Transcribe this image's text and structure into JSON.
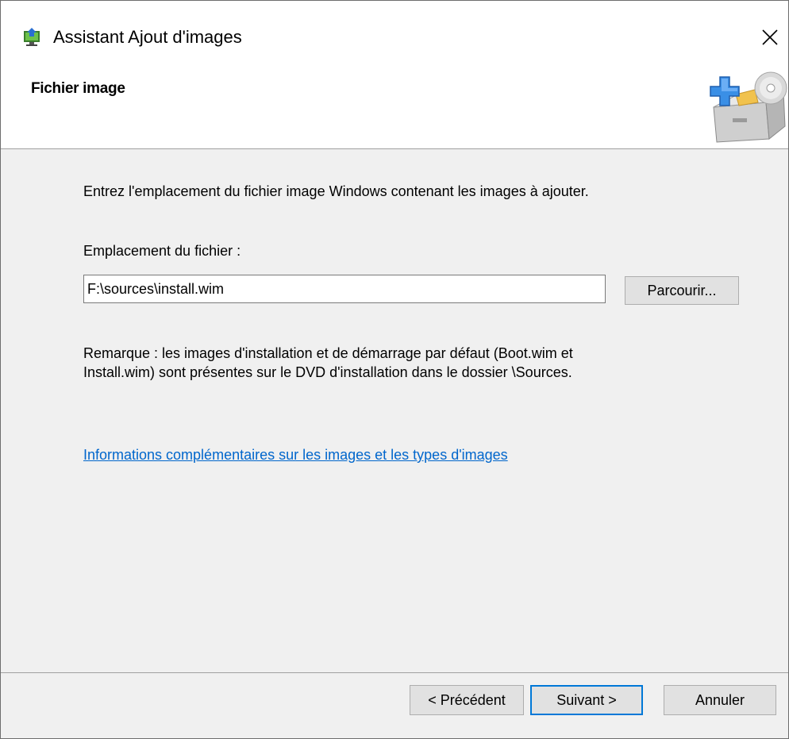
{
  "window": {
    "title": "Assistant Ajout d'images"
  },
  "header": {
    "title": "Fichier image"
  },
  "main": {
    "instruction": "Entrez l'emplacement du fichier image Windows contenant les images à ajouter.",
    "file_location_label": "Emplacement du fichier :",
    "file_path_value": "F:\\sources\\install.wim",
    "browse_label": "Parcourir...",
    "note_line1": "Remarque : les images d'installation et de démarrage par défaut (Boot.wim et",
    "note_line2": "Install.wim) sont présentes sur le DVD d'installation dans le dossier \\Sources.",
    "info_link": "Informations complémentaires sur les images et les types d'images"
  },
  "footer": {
    "back_label": "< Précédent",
    "next_label": "Suivant >",
    "cancel_label": "Annuler"
  },
  "icons": {
    "app": "wds-add-image-icon",
    "close": "close-icon",
    "header": "add-image-archive-icon"
  },
  "colors": {
    "accent": "#0078d7",
    "link": "#0066cc",
    "dialog_bg": "#f0f0f0"
  }
}
